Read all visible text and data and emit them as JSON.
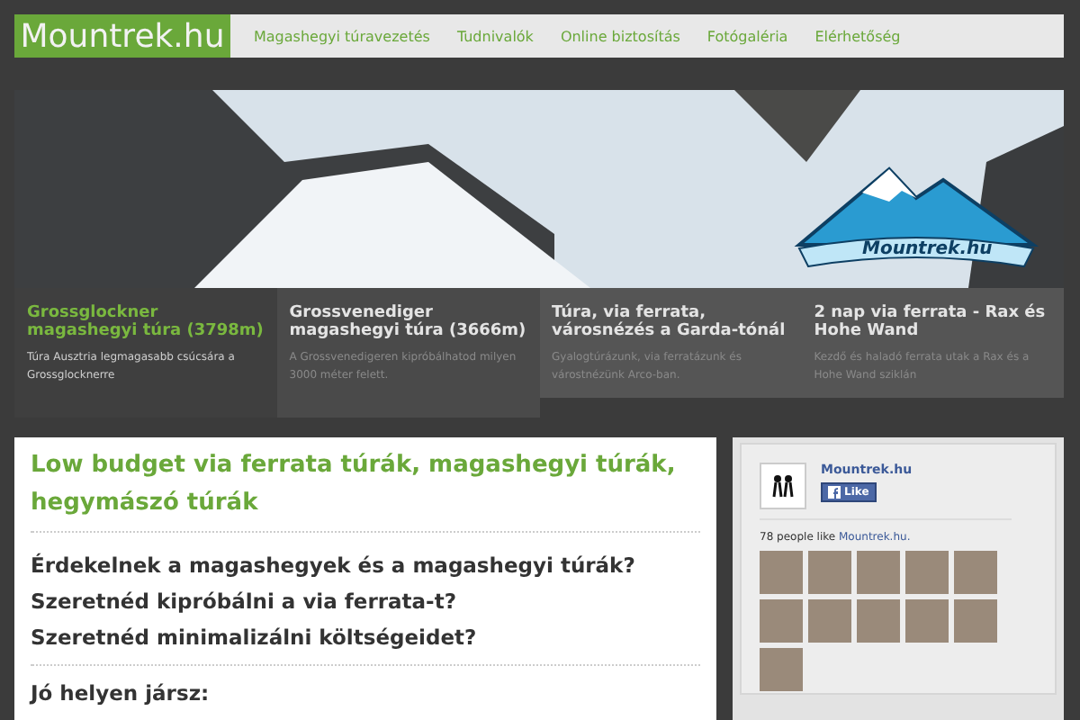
{
  "header": {
    "logo": "Mountrek.hu",
    "nav": [
      "Magashegyi túravezetés",
      "Tudnivalók",
      "Online biztosítás",
      "Fotógaléria",
      "Elérhetőség"
    ]
  },
  "hero": {
    "logo_text": "Mountrek.hu"
  },
  "slides": [
    {
      "title": "Grossglockner magashegyi túra (3798m)",
      "text": "Túra Ausztria legmagasabb csúcsára a Grossglocknerre",
      "selected": true
    },
    {
      "title": "Grossvenediger magashegyi túra (3666m)",
      "text": "A Grossvenedigeren kipróbálhatod milyen 3000 méter felett.",
      "selected": false
    },
    {
      "title": "Túra, via ferrata, városnézés a Garda-tónál",
      "text": "Gyalogtúrázunk, via ferratázunk és várostnézünk Arco-ban.",
      "selected": false
    },
    {
      "title": "2 nap via ferrata - Rax és Hohe Wand",
      "text": "Kezdő és haladó ferrata utak a Rax és a Hohe Wand sziklán",
      "selected": false
    }
  ],
  "main": {
    "heading": "Low budget via ferrata túrák, magashegyi túrák, hegymászó túrák",
    "questions": [
      "Érdekelnek a magashegyek és a magashegyi túrák?",
      "Szeretnéd kipróbálni a via ferrata-t?",
      "Szeretnéd minimalizálni költségeidet?"
    ],
    "subheading": "Jó helyen jársz:"
  },
  "facebook": {
    "page_name": "Mountrek.hu",
    "like_button": "Like",
    "count_text": "78 people like",
    "count_link": "Mountrek.hu."
  }
}
